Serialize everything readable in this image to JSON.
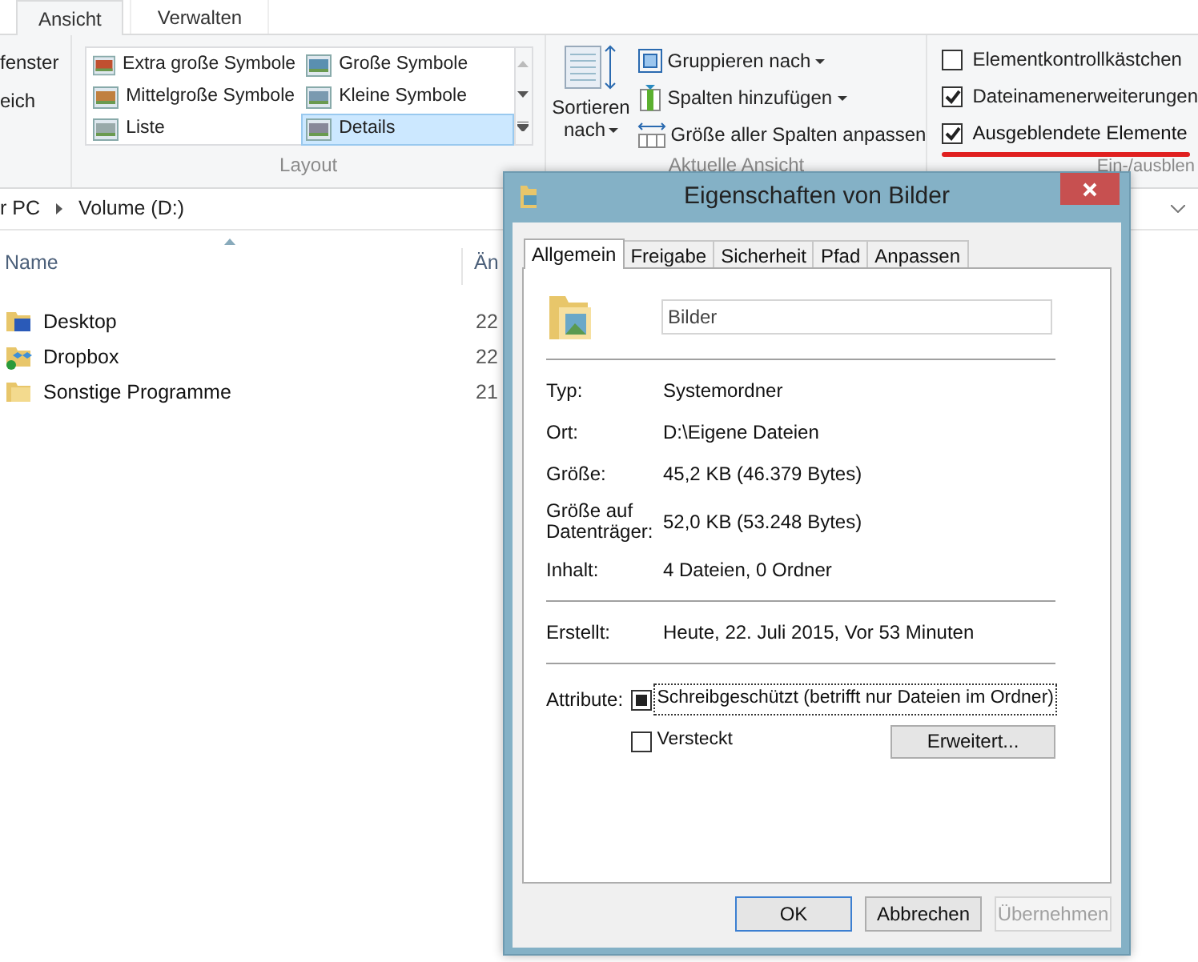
{
  "ribbon": {
    "tabs": [
      {
        "label": "Ansicht",
        "selected": true
      },
      {
        "label": "Verwalten",
        "selected": false
      }
    ],
    "cut_group_items": [
      "fenster",
      "eich"
    ],
    "layout_group": {
      "label": "Layout",
      "items": [
        {
          "label": "Extra große Symbole",
          "selected": false
        },
        {
          "label": "Große Symbole",
          "selected": false
        },
        {
          "label": "Mittelgroße Symbole",
          "selected": false
        },
        {
          "label": "Kleine Symbole",
          "selected": false
        },
        {
          "label": "Liste",
          "selected": false
        },
        {
          "label": "Details",
          "selected": true
        }
      ]
    },
    "current_view_group": {
      "label": "Aktuelle Ansicht",
      "sort_button": {
        "line_1": "Sortieren",
        "line_2": "nach"
      },
      "items": [
        {
          "label": "Gruppieren nach",
          "kind": "group",
          "dropdown": true
        },
        {
          "label": "Spalten hinzufügen",
          "kind": "columns",
          "dropdown": true
        },
        {
          "label": "Größe aller Spalten anpassen",
          "kind": "fit",
          "dropdown": false
        }
      ]
    },
    "show_hide_group": {
      "label": "Ein-/ausblen",
      "checkboxes": [
        {
          "label": "Elementkontrollkästchen",
          "checked": false,
          "marked": false
        },
        {
          "label": "Dateinamenerweiterungen",
          "checked": true,
          "marked": false
        },
        {
          "label": "Ausgeblendete Elemente",
          "checked": true,
          "marked": true
        }
      ]
    }
  },
  "address_bar": {
    "segments": [
      "r PC",
      "Volume (D:)"
    ]
  },
  "file_list": {
    "columns": [
      "Name",
      "Än"
    ],
    "rows": [
      {
        "name": "Desktop",
        "column_2": "22",
        "kind": "desktop"
      },
      {
        "name": "Dropbox",
        "column_2": "22",
        "kind": "dropbox"
      },
      {
        "name": "Sonstige Programme",
        "column_2": "21",
        "kind": "folder"
      }
    ]
  },
  "dialog": {
    "title": "Eigenschaften von Bilder",
    "tabs": [
      {
        "label": "Allgemein",
        "selected": true
      },
      {
        "label": "Freigabe",
        "selected": false
      },
      {
        "label": "Sicherheit",
        "selected": false
      },
      {
        "label": "Pfad",
        "selected": false
      },
      {
        "label": "Anpassen",
        "selected": false
      }
    ],
    "name_field": {
      "value": "Bilder"
    },
    "sections": [
      [
        {
          "label": "Typ:",
          "value": "Systemordner"
        },
        {
          "label": "Ort:",
          "value": "D:\\Eigene Dateien"
        },
        {
          "label": "Größe:",
          "value": "45,2 KB (46.379 Bytes)"
        },
        {
          "label": "Größe auf Datenträger:",
          "value": "52,0 KB (53.248 Bytes)"
        },
        {
          "label": "Inhalt:",
          "value": "4 Dateien, 0 Ordner"
        }
      ],
      [
        {
          "label": "Erstellt:",
          "value": "Heute, 22. Juli 2015, Vor 53 Minuten"
        }
      ]
    ],
    "attributes": {
      "label": "Attribute:",
      "checkboxes": [
        {
          "label": "Schreibgeschützt (betrifft nur Dateien im Ordner)",
          "checked": false,
          "indeterminate": true,
          "focused": true
        },
        {
          "label": "Versteckt",
          "checked": false,
          "indeterminate": false,
          "focused": false
        }
      ],
      "advanced_button": "Erweitert..."
    },
    "buttons": [
      {
        "label": "OK",
        "default": true,
        "disabled": false
      },
      {
        "label": "Abbrechen",
        "default": false,
        "disabled": false
      },
      {
        "label": "Übernehmen",
        "default": false,
        "disabled": true
      }
    ]
  }
}
